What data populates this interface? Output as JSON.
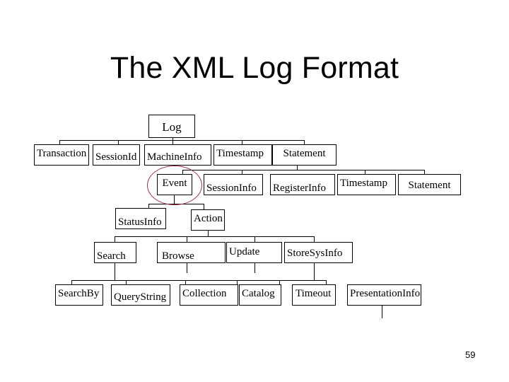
{
  "slide": {
    "title": "The XML Log Format",
    "page_number": "59"
  },
  "diagram": {
    "type": "tree",
    "highlight_color": "#a03040",
    "highlighted_node": "Event",
    "nodes": {
      "log": "Log",
      "transaction": "Transaction",
      "sessionid": "SessionId",
      "machineinfo": "MachineInfo",
      "timestamp1": "Timestamp",
      "statement1": "Statement",
      "event": "Event",
      "sessioninfo": "SessionInfo",
      "registerinfo": "RegisterInfo",
      "timestamp2": "Timestamp",
      "statement2": "Statement",
      "statusinfo": "StatusInfo",
      "action": "Action",
      "search": "Search",
      "browse": "Browse",
      "update": "Update",
      "storesysinfo": "StoreSysInfo",
      "searchby": "SearchBy",
      "querystring": "QueryString",
      "collection": "Collection",
      "catalog": "Catalog",
      "timeout": "Timeout",
      "presentationinfo": "PresentationInfo"
    },
    "edges": [
      [
        "Log",
        "Transaction"
      ],
      [
        "Log",
        "SessionId"
      ],
      [
        "Log",
        "MachineInfo"
      ],
      [
        "Log",
        "Timestamp"
      ],
      [
        "Log",
        "Statement"
      ],
      [
        "Statement",
        "Event"
      ],
      [
        "Statement",
        "SessionInfo"
      ],
      [
        "Statement",
        "RegisterInfo"
      ],
      [
        "Statement",
        "Timestamp"
      ],
      [
        "Statement",
        "Statement"
      ],
      [
        "Event",
        "StatusInfo"
      ],
      [
        "Event",
        "Action"
      ],
      [
        "Action",
        "Search"
      ],
      [
        "Action",
        "Browse"
      ],
      [
        "Action",
        "Update"
      ],
      [
        "Action",
        "StoreSysInfo"
      ],
      [
        "Search",
        "SearchBy"
      ],
      [
        "Search",
        "QueryString"
      ],
      [
        "Search",
        "Collection"
      ],
      [
        "Search",
        "Catalog"
      ],
      [
        "Search",
        "Timeout"
      ],
      [
        "Search",
        "PresentationInfo"
      ]
    ]
  }
}
